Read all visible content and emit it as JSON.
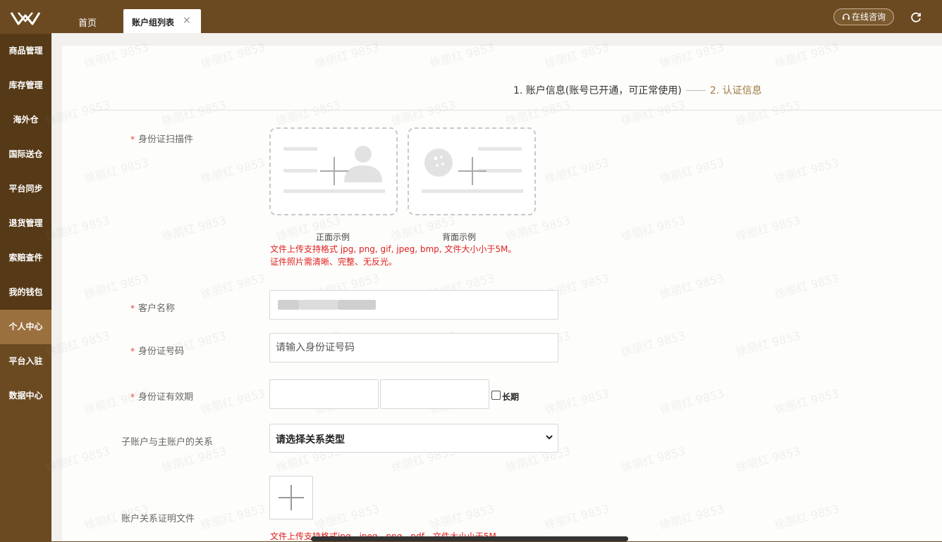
{
  "sidebar": {
    "items": [
      {
        "label": "商品管理",
        "style": "dark"
      },
      {
        "label": "库存管理",
        "style": "dark"
      },
      {
        "label": "海外仓",
        "style": "dark"
      },
      {
        "label": "国际送仓",
        "style": "dark"
      },
      {
        "label": "平台同步",
        "style": "dark"
      },
      {
        "label": "退货管理",
        "style": "dark"
      },
      {
        "label": "索赔查件",
        "style": "dark"
      },
      {
        "label": "我的钱包",
        "style": "dark"
      },
      {
        "label": "个人中心",
        "style": "active"
      },
      {
        "label": "平台入驻",
        "style": "plain"
      },
      {
        "label": "数据中心",
        "style": "plain"
      }
    ]
  },
  "header": {
    "tabs": [
      {
        "label": "首页"
      },
      {
        "label": "账户组列表",
        "close": "×"
      }
    ],
    "consult_label": "在线咨询"
  },
  "steps": {
    "step1": "1. 账户信息(账号已开通，可正常使用)",
    "step2": "2. 认证信息"
  },
  "form": {
    "id_scan": {
      "label": "身份证扫描件",
      "front_caption": "正面示例",
      "back_caption": "背面示例",
      "note1": "文件上传支持格式 jpg, png, gif, jpeg, bmp, 文件大小小于5M。",
      "note2": "证件照片需清晰、完整、无反光。"
    },
    "customer_name": {
      "label": "客户名称"
    },
    "id_number": {
      "label": "身份证号码",
      "placeholder": "请输入身份证号码"
    },
    "id_validity": {
      "label": "身份证有效期",
      "long_term_label": "长期"
    },
    "relation": {
      "label": "子账户与主账户的关系",
      "selected": "请选择关系类型"
    },
    "relation_doc": {
      "label": "账户关系证明文件",
      "note": "文件上传支持格式jpg，jpeg，png，pdf，文件大小小于5M"
    }
  },
  "watermark": "徐丽红 9853",
  "colors": {
    "brand": "#6b4a22",
    "active": "#9a703e",
    "required": "#e44444",
    "note": "#e0201f",
    "step_current": "#a07a45"
  }
}
